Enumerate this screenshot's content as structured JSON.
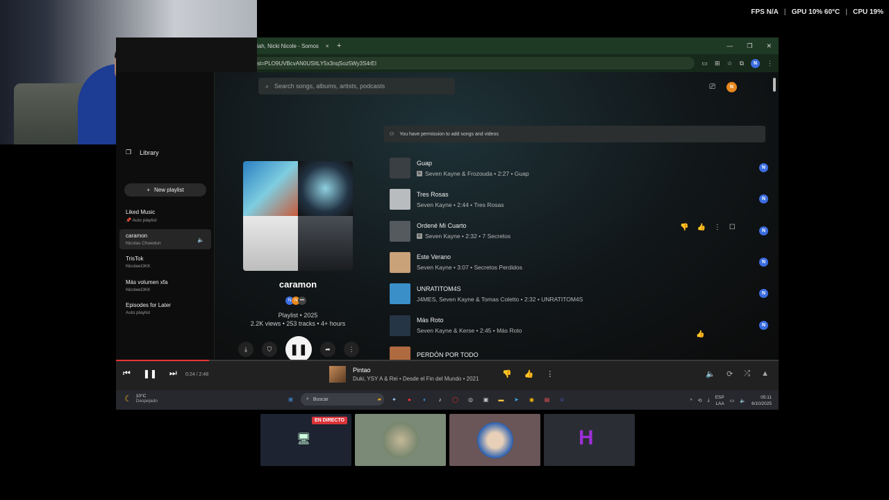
{
  "overlay": {
    "fps": "FPS N/A",
    "gpu": "GPU 10% 60°C",
    "cpu": "CPU 19%"
  },
  "browser": {
    "tab_title": "iah, Nicki Nicole - Somos",
    "tab_close": "×",
    "new_tab": "+",
    "url": "st=PLO9UVBcvAN0USItLY5x3nqSoz5Wy3S4rEI",
    "win_minimize": "—",
    "win_restore": "❐",
    "win_close": "✕",
    "profile_initial": "N"
  },
  "app": {
    "search_placeholder": "Search songs, albums, artists, podcasts",
    "account_initial": "N",
    "permission_text": "You have permission to add songs and videos",
    "sidebar": {
      "library_label": "Library",
      "new_playlist_label": "New playlist",
      "playlists": [
        {
          "title": "Liked Music",
          "subtitle": "Auto playlist"
        },
        {
          "title": "caramon",
          "subtitle": "Nicolas Chwedun"
        },
        {
          "title": "TrisTok",
          "subtitle": "NicoleeOKK"
        },
        {
          "title": "Más volumen xfa",
          "subtitle": "NicoleeOKK"
        },
        {
          "title": "Episodes for Later",
          "subtitle": "Auto playlist"
        }
      ]
    },
    "playlist": {
      "title": "caramon",
      "collab_initials": [
        "N",
        "N"
      ],
      "type_year": "Playlist • 2025",
      "stats": "2.2K views • 253 tracks • 4+ hours"
    },
    "tracks": [
      {
        "name": "Guap",
        "meta": "Seven Kayne & Frozouda • 2:27 • Guap",
        "explicit": true,
        "color": "#3a3f44"
      },
      {
        "name": "Tres Rosas",
        "meta": "Seven Kayne • 2:44 • Tres Rosas",
        "explicit": false,
        "color": "#b9bcbf"
      },
      {
        "name": "Ordené Mi Cuarto",
        "meta": "Seven Kayne • 2:32 • 7 Secretos",
        "explicit": true,
        "color": "#555a5e"
      },
      {
        "name": "Este Verano",
        "meta": "Seven Kayne • 3:07 • Secretos Perdidos",
        "explicit": false,
        "color": "#c9a27a"
      },
      {
        "name": "UNRATITOM4S",
        "meta": "J4MES, Seven Kayne & Tomas Coletto • 2:32 • UNRATITOM4S",
        "explicit": false,
        "color": "#3a8fc8"
      },
      {
        "name": "Más Roto",
        "meta": "Seven Kayne & Kerse • 2:45 • Más Roto",
        "explicit": false,
        "color": "#253545"
      },
      {
        "name": "PERDÓN POR TODO",
        "meta": "",
        "explicit": false,
        "color": "#b06a40"
      }
    ],
    "player": {
      "time": "0:24 / 2:48",
      "progress": 0.14,
      "song": "Pintao",
      "details": "Duki, YSY A & Rei • Desde el Fin del Mundo • 2021"
    }
  },
  "taskbar": {
    "temperature": "10°C",
    "weather_text": "Despejado",
    "search_label": "Buscar",
    "lang1": "ESP",
    "lang2": "LAA",
    "time": "05:11",
    "date": "6/10/2025"
  },
  "thumbnails": {
    "live_badge": "EN DIRECTO"
  },
  "colors": {
    "accent_red": "#e33333",
    "avatar_blue": "#3b6de0",
    "avatar_orange": "#e8871e",
    "live_red": "#d9343a"
  }
}
